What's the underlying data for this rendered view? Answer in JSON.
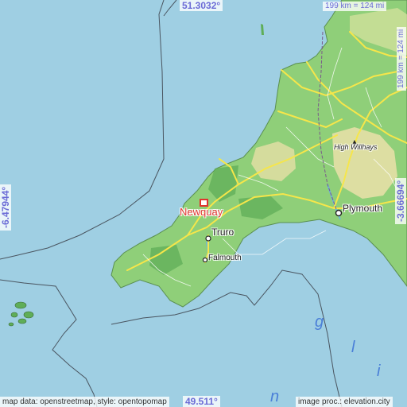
{
  "coords": {
    "north": "51.3032°",
    "south": "49.511°",
    "west": "-6.47944°",
    "east": "-3.66694°"
  },
  "scale": {
    "top": "199 km = 124 mi",
    "right": "199 km = 124 mi"
  },
  "places": {
    "target": "Newquay",
    "truro": "Truro",
    "falmouth": "Falmouth",
    "plymouth": "Plymouth",
    "high_willhays": "High Willhays"
  },
  "sea_label": [
    "n",
    "g",
    "l",
    "i"
  ],
  "attribution": {
    "left": "map data: openstreetmap, style: opentopomap",
    "right": "image proc.: elevation.city"
  },
  "colors": {
    "sea": "#9fcfe3",
    "lowland": "#8fcf79",
    "upland": "#e6dfa6",
    "road": "#f6e64a",
    "target_marker": "#e0342e",
    "coord_text": "#6b6bd6"
  }
}
